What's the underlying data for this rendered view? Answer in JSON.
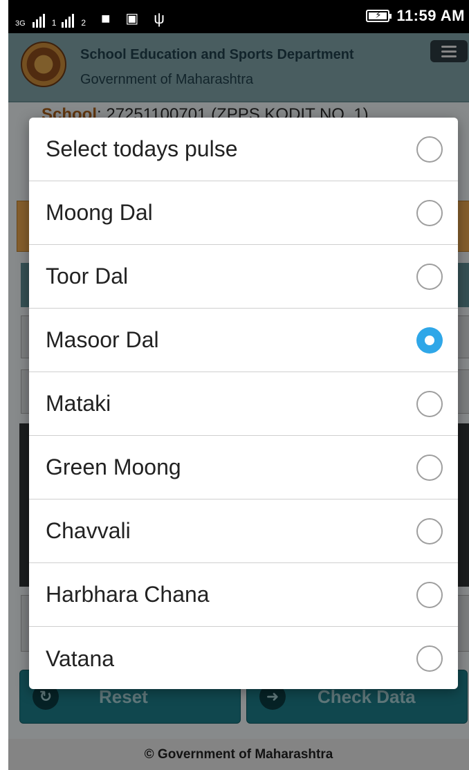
{
  "status_bar": {
    "network_type": "3G",
    "sim1": "1",
    "sim2": "2",
    "icons": [
      "message-icon",
      "image-icon",
      "usb-icon",
      "battery-charging-icon"
    ],
    "time": "11:59 AM"
  },
  "header": {
    "title": "School Education and Sports Department",
    "subtitle": "Government of Maharashtra",
    "logo": "maharashtra-seal",
    "menu_icon": "hamburger-menu-icon"
  },
  "background": {
    "school_label": "School",
    "school_value": ": 27251100701 (ZPPS KODIT NO. 1)",
    "reset_label": "Reset",
    "check_data_label": "Check Data",
    "footer": "© Government of Maharashtra"
  },
  "dialog": {
    "options": [
      {
        "label": "Select todays pulse",
        "selected": false
      },
      {
        "label": "Moong Dal",
        "selected": false
      },
      {
        "label": "Toor Dal",
        "selected": false
      },
      {
        "label": "Masoor Dal",
        "selected": true
      },
      {
        "label": "Mataki",
        "selected": false
      },
      {
        "label": "Green Moong",
        "selected": false
      },
      {
        "label": "Chavvali",
        "selected": false
      },
      {
        "label": "Harbhara Chana",
        "selected": false
      },
      {
        "label": "Vatana",
        "selected": false
      }
    ]
  },
  "colors": {
    "radio_selected": "#2fa7e8",
    "header_bg": "#7fa1a5",
    "button_bg": "#1d7b87"
  }
}
